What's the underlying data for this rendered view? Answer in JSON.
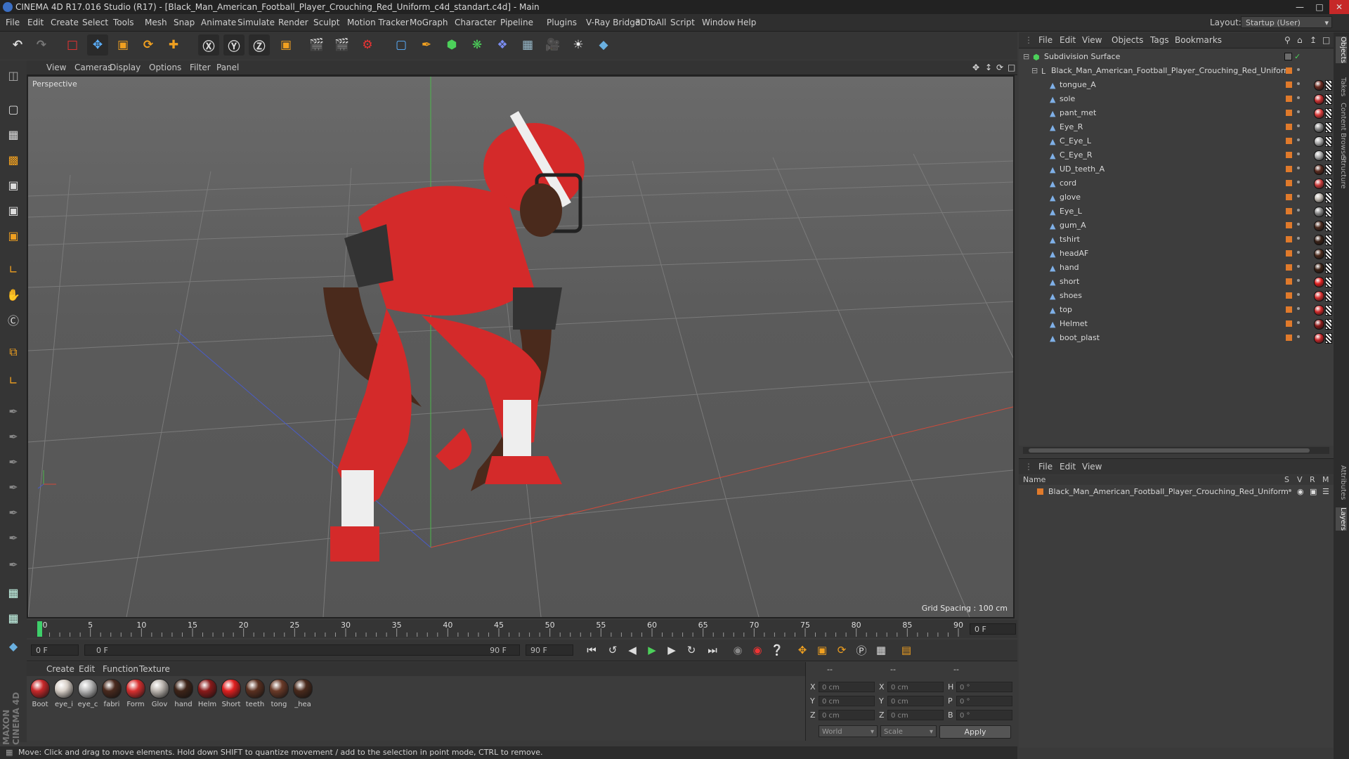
{
  "window": {
    "title": "CINEMA 4D R17.016 Studio (R17) - [Black_Man_American_Football_Player_Crouching_Red_Uniform_c4d_standart.c4d] - Main"
  },
  "menubar": {
    "items": [
      "File",
      "Edit",
      "Create",
      "Select",
      "Tools",
      "Mesh",
      "Snap",
      "Animate",
      "Simulate",
      "Render",
      "Sculpt",
      "Motion Tracker",
      "MoGraph",
      "Character",
      "Pipeline",
      "Plugins",
      "V-Ray Bridge",
      "3DToAll",
      "Script",
      "Window",
      "Help"
    ],
    "layout_label": "Layout:",
    "layout_value": "Startup (User)"
  },
  "viewport": {
    "menu": [
      "View",
      "Cameras",
      "Display",
      "Options",
      "Filter",
      "Panel"
    ],
    "camera_label": "Perspective",
    "grid_spacing": "Grid Spacing : 100 cm"
  },
  "timeline": {
    "ticks": [
      "0",
      "5",
      "10",
      "15",
      "20",
      "25",
      "30",
      "35",
      "40",
      "45",
      "50",
      "55",
      "60",
      "65",
      "70",
      "75",
      "80",
      "85",
      "90"
    ],
    "current_frame": "0 F",
    "start_field": "0 F",
    "range_start": "0 F",
    "range_end": "90 F",
    "end_field": "90 F"
  },
  "material_manager": {
    "menu": [
      "Create",
      "Edit",
      "Function",
      "Texture"
    ],
    "materials": [
      {
        "label": "Boot",
        "color": "#c8282a"
      },
      {
        "label": "eye_i",
        "color": "#d8d0c8"
      },
      {
        "label": "eye_c",
        "color": "#b9b9b9"
      },
      {
        "label": "fabri",
        "color": "#4a2a1e"
      },
      {
        "label": "Form",
        "color": "#d83030"
      },
      {
        "label": "Glov",
        "color": "#bcb6b0"
      },
      {
        "label": "hand",
        "color": "#3e2418"
      },
      {
        "label": "Helm",
        "color": "#8a1a1a"
      },
      {
        "label": "Short",
        "color": "#e02020"
      },
      {
        "label": "teeth",
        "color": "#5a3020"
      },
      {
        "label": "tong",
        "color": "#6a3a28"
      },
      {
        "label": "_hea",
        "color": "#4a2a1c"
      }
    ]
  },
  "coordinates": {
    "header": [
      "--",
      "--",
      "--"
    ],
    "rows": [
      {
        "a": "X",
        "av": "0 cm",
        "b": "X",
        "bv": "0 cm",
        "c": "H",
        "cv": "0 °"
      },
      {
        "a": "Y",
        "av": "0 cm",
        "b": "Y",
        "bv": "0 cm",
        "c": "P",
        "cv": "0 °"
      },
      {
        "a": "Z",
        "av": "0 cm",
        "b": "Z",
        "bv": "0 cm",
        "c": "B",
        "cv": "0 °"
      }
    ],
    "world": "World",
    "scale": "Scale",
    "apply": "Apply"
  },
  "status": {
    "text": "Move: Click and drag to move elements. Hold down SHIFT to quantize movement / add to the selection in point mode, CTRL to remove."
  },
  "object_manager": {
    "menu": [
      "File",
      "Edit",
      "View",
      "Objects",
      "Tags",
      "Bookmarks"
    ],
    "root": "Subdivision Surface",
    "group": "Black_Man_American_Football_Player_Crouching_Red_Uniform",
    "objects": [
      {
        "name": "tongue_A",
        "tag": "#6a2a20"
      },
      {
        "name": "sole",
        "tag": "#c83030"
      },
      {
        "name": "pant_met",
        "tag": "#d83a3a"
      },
      {
        "name": "Eye_R",
        "tag": "#888"
      },
      {
        "name": "C_Eye_L",
        "tag": "#aaa"
      },
      {
        "name": "C_Eye_R",
        "tag": "#aaa"
      },
      {
        "name": "UD_teeth_A",
        "tag": "#5a2a1e"
      },
      {
        "name": "cord",
        "tag": "#c83a3a"
      },
      {
        "name": "glove",
        "tag": "#bfb8b0"
      },
      {
        "name": "Eye_L",
        "tag": "#888"
      },
      {
        "name": "gum_A",
        "tag": "#4a2a1e"
      },
      {
        "name": "tshirt",
        "tag": "#3a2218"
      },
      {
        "name": "headAF",
        "tag": "#4a2a1c"
      },
      {
        "name": "hand",
        "tag": "#3e2418"
      },
      {
        "name": "short",
        "tag": "#e02020"
      },
      {
        "name": "shoes",
        "tag": "#d83030"
      },
      {
        "name": "top",
        "tag": "#d02a2a"
      },
      {
        "name": "Helmet",
        "tag": "#8a1a1a"
      },
      {
        "name": "boot_plast",
        "tag": "#c8282a"
      }
    ]
  },
  "layer_manager": {
    "menu": [
      "File",
      "Edit",
      "View"
    ],
    "headers": {
      "name": "Name",
      "s": "S",
      "v": "V",
      "r": "R",
      "m": "M"
    },
    "layers": [
      {
        "name": "Black_Man_American_Football_Player_Crouching_Red_Uniform"
      }
    ]
  },
  "right_tabs": [
    "Objects",
    "Takes",
    "Content Browser",
    "Structure",
    "Attributes",
    "Layers"
  ],
  "colors": {
    "accent_orange": "#e07a2b",
    "uniform_red": "#d42a2a"
  }
}
